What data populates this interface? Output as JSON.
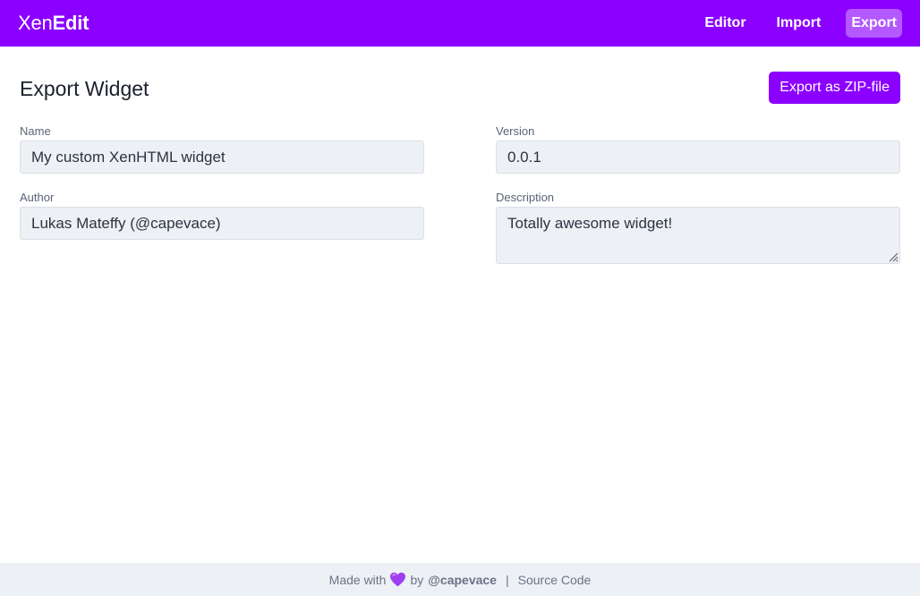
{
  "header": {
    "brand_light": "Xen",
    "brand_bold": "Edit",
    "nav": [
      {
        "label": "Editor",
        "active": false
      },
      {
        "label": "Import",
        "active": false
      },
      {
        "label": "Export",
        "active": true
      }
    ],
    "accent_color": "#8b00ff"
  },
  "main": {
    "title": "Export Widget",
    "export_button_label": "Export as ZIP-file",
    "fields": {
      "name": {
        "label": "Name",
        "value": "My custom XenHTML widget"
      },
      "version": {
        "label": "Version",
        "value": "0.0.1"
      },
      "author": {
        "label": "Author",
        "value": "Lukas Mateffy (@capevace)"
      },
      "description": {
        "label": "Description",
        "value": "Totally awesome widget!"
      }
    }
  },
  "footer": {
    "made_with": "Made with",
    "heart_icon": "purple-heart-icon",
    "by": "by",
    "handle": "@capevace",
    "separator": "|",
    "source_link": "Source Code"
  }
}
